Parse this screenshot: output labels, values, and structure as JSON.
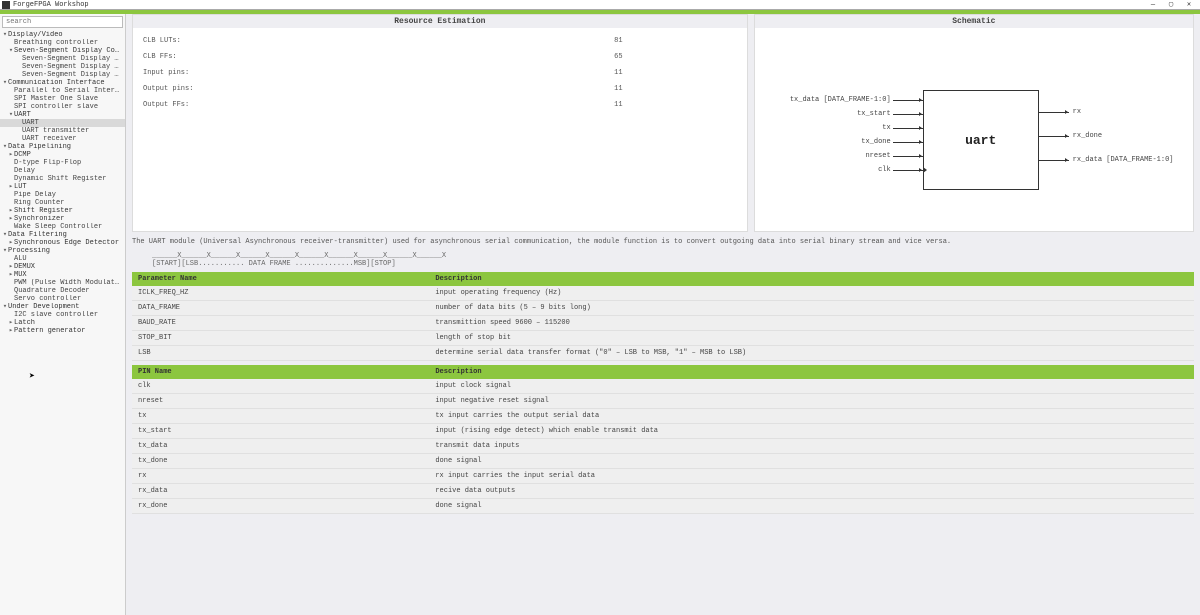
{
  "window": {
    "title": "ForgeFPGA Workshop"
  },
  "search": {
    "placeholder": "search"
  },
  "tree": [
    {
      "d": 0,
      "t": "▾",
      "label": "Display/Video"
    },
    {
      "d": 1,
      "t": "",
      "label": "Breathing controller"
    },
    {
      "d": 1,
      "t": "▾",
      "label": "Seven-Segment Display Co…"
    },
    {
      "d": 2,
      "t": "",
      "label": "Seven-Segment Display …"
    },
    {
      "d": 2,
      "t": "",
      "label": "Seven-Segment Display …"
    },
    {
      "d": 2,
      "t": "",
      "label": "Seven-Segment Display …"
    },
    {
      "d": 0,
      "t": "▾",
      "label": "Communication Interface"
    },
    {
      "d": 1,
      "t": "",
      "label": "Parallel to Serial Inter…"
    },
    {
      "d": 1,
      "t": "",
      "label": "SPI Master One Slave"
    },
    {
      "d": 1,
      "t": "",
      "label": "SPI controller slave"
    },
    {
      "d": 1,
      "t": "▾",
      "label": "UART"
    },
    {
      "d": 2,
      "t": "",
      "label": "UART",
      "sel": true
    },
    {
      "d": 2,
      "t": "",
      "label": "UART transmitter"
    },
    {
      "d": 2,
      "t": "",
      "label": "UART receiver"
    },
    {
      "d": 0,
      "t": "▾",
      "label": "Data Pipelining"
    },
    {
      "d": 1,
      "t": "▸",
      "label": "DCMP"
    },
    {
      "d": 1,
      "t": "",
      "label": "D-type Flip-Flop"
    },
    {
      "d": 1,
      "t": "",
      "label": "Delay"
    },
    {
      "d": 1,
      "t": "",
      "label": "Dynamic Shift Register"
    },
    {
      "d": 1,
      "t": "▸",
      "label": "LUT"
    },
    {
      "d": 1,
      "t": "",
      "label": "Pipe Delay"
    },
    {
      "d": 1,
      "t": "",
      "label": "Ring Counter"
    },
    {
      "d": 1,
      "t": "▸",
      "label": "Shift Register"
    },
    {
      "d": 1,
      "t": "▸",
      "label": "Synchronizer"
    },
    {
      "d": 1,
      "t": "",
      "label": "Wake Sleep Controller"
    },
    {
      "d": 0,
      "t": "▾",
      "label": "Data Filtering"
    },
    {
      "d": 1,
      "t": "▸",
      "label": "Synchronous Edge Detector"
    },
    {
      "d": 0,
      "t": "▾",
      "label": "Processing"
    },
    {
      "d": 1,
      "t": "",
      "label": "ALU"
    },
    {
      "d": 1,
      "t": "▸",
      "label": "DEMUX"
    },
    {
      "d": 1,
      "t": "▸",
      "label": "MUX"
    },
    {
      "d": 1,
      "t": "",
      "label": "PWM (Pulse Width Modulat…"
    },
    {
      "d": 1,
      "t": "",
      "label": "Quadrature Decoder"
    },
    {
      "d": 1,
      "t": "",
      "label": "Servo controller"
    },
    {
      "d": 0,
      "t": "▾",
      "label": "Under Development"
    },
    {
      "d": 1,
      "t": "",
      "label": "I2C slave controller"
    },
    {
      "d": 1,
      "t": "▸",
      "label": "Latch"
    },
    {
      "d": 1,
      "t": "▸",
      "label": "Pattern generator"
    }
  ],
  "panels": {
    "resources_title": "Resource Estimation",
    "schematic_title": "Schematic"
  },
  "resources": [
    {
      "name": "CLB LUTs:",
      "val": "81"
    },
    {
      "name": "CLB FFs:",
      "val": "65"
    },
    {
      "name": "Input pins:",
      "val": "11"
    },
    {
      "name": "Output pins:",
      "val": "11"
    },
    {
      "name": "Output FFs:",
      "val": "11"
    }
  ],
  "schematic": {
    "block_name": "uart",
    "left_pins": [
      "tx_data [DATA_FRAME-1:0]",
      "tx_start",
      "tx",
      "tx_done",
      "nreset",
      "clk"
    ],
    "right_pins": [
      "rx",
      "rx_done",
      "rx_data [DATA_FRAME-1:0]"
    ]
  },
  "description": "The UART module (Universal Asynchronous receiver-transmitter) used for asynchronous serial communication, the module function is to convert outgoing data into serial binary stream and vice versa.",
  "ascii_frame": "______X______X______X______X______X______X______X______X______X______X\n[START][LSB........... DATA FRAME ..............MSB][STOP]",
  "param_headers": {
    "name": "Parameter Name",
    "desc": "Description"
  },
  "params": [
    {
      "name": "ICLK_FREQ_HZ",
      "desc": "input operating frequency (Hz)"
    },
    {
      "name": "DATA_FRAME",
      "desc": "number of data bits (5 – 9 bits long)"
    },
    {
      "name": "BAUD_RATE",
      "desc": "transmittion speed 9600 – 115200"
    },
    {
      "name": "STOP_BIT",
      "desc": "length of stop bit"
    },
    {
      "name": "LSB",
      "desc": "determine serial data transfer format (\"0\" – LSB to MSB, \"1\" – MSB to LSB)"
    }
  ],
  "pin_headers": {
    "name": "PIN Name",
    "desc": "Description"
  },
  "pins": [
    {
      "name": "clk",
      "desc": "input clock signal"
    },
    {
      "name": "nreset",
      "desc": "input negative reset signal"
    },
    {
      "name": "tx",
      "desc": "tx input carries the output serial data"
    },
    {
      "name": "tx_start",
      "desc": "input (rising edge detect) which enable transmit data"
    },
    {
      "name": "tx_data",
      "desc": "transmit data inputs"
    },
    {
      "name": "tx_done",
      "desc": "done signal"
    },
    {
      "name": "rx",
      "desc": "rx input carries the input serial data"
    },
    {
      "name": "rx_data",
      "desc": "recive data outputs"
    },
    {
      "name": "rx_done",
      "desc": "done signal"
    }
  ]
}
